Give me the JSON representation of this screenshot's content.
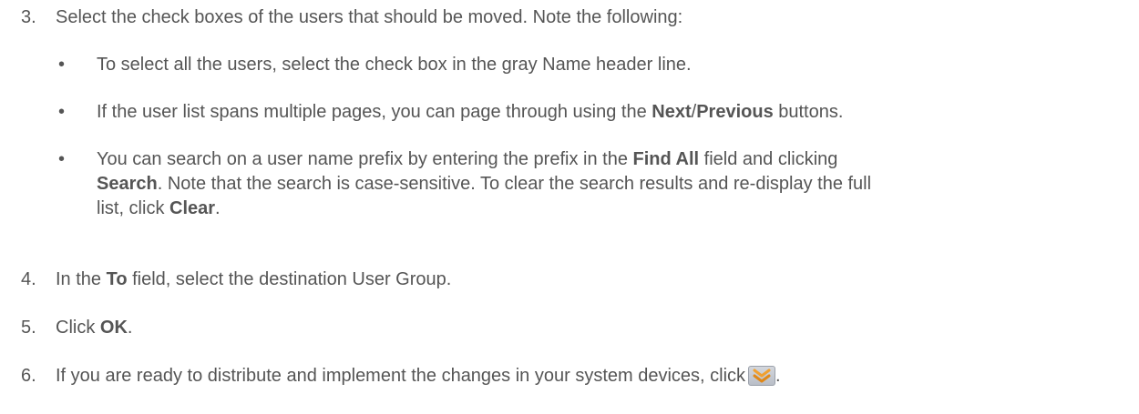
{
  "steps": [
    {
      "num": "3.",
      "text": "Select the check boxes of the users that should be moved. Note the following:"
    },
    {
      "num": "4.",
      "pre": "In the ",
      "bold": "To",
      "post": " field, select the destination User Group."
    },
    {
      "num": "5.",
      "pre": "Click ",
      "bold": "OK",
      "post": "."
    },
    {
      "num": "6.",
      "pre": "If you are ready to distribute and implement the changes in your system devices, click",
      "post": "."
    }
  ],
  "bullets": [
    {
      "dot": "•",
      "text": "To select all the users, select the check box in the gray Name header line."
    },
    {
      "dot": "•",
      "pre": "If the user list spans multiple pages, you can page through using the ",
      "bold1": "Next",
      "mid": "/",
      "bold2": "Previous",
      "post": " buttons."
    },
    {
      "dot": "•",
      "l1_pre": "You can search on a user name prefix by entering the prefix in the ",
      "l1_bold": "Find All",
      "l1_post": " field and clicking",
      "l2_bold": "Search",
      "l2_post": ". Note that the search is case-sensitive. To clear the search results and re-display the full",
      "l3_pre": "list, click ",
      "l3_bold": "Clear",
      "l3_post": "."
    }
  ],
  "icons": {
    "deploy": "deploy-changes-icon"
  },
  "colors": {
    "text": "#555555",
    "icon_orange": "#f0a030"
  }
}
